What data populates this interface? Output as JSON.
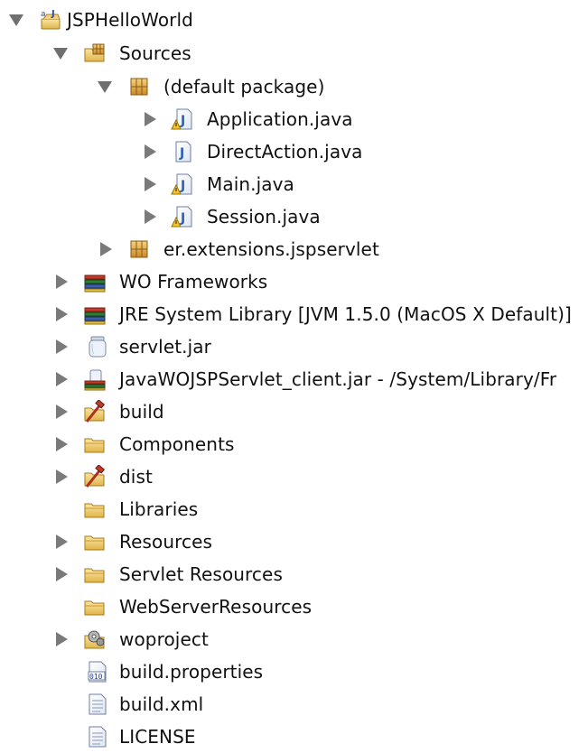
{
  "tree": {
    "root": {
      "label": "JSPHelloWorld",
      "icon": "web-project-icon",
      "state": "expanded"
    },
    "sources": {
      "label": "Sources",
      "icon": "source-folder-icon",
      "state": "expanded"
    },
    "default_package": {
      "label": "(default package)",
      "icon": "package-icon",
      "state": "expanded"
    },
    "files": [
      {
        "label": "Application.java",
        "icon": "java-file-warning-icon",
        "state": "collapsed"
      },
      {
        "label": "DirectAction.java",
        "icon": "java-file-icon",
        "state": "collapsed"
      },
      {
        "label": "Main.java",
        "icon": "java-file-warning-icon",
        "state": "collapsed"
      },
      {
        "label": "Session.java",
        "icon": "java-file-warning-icon",
        "state": "collapsed"
      }
    ],
    "er_package": {
      "label": "er.extensions.jspservlet",
      "icon": "package-icon",
      "state": "collapsed"
    },
    "items": [
      {
        "label": "WO Frameworks",
        "icon": "library-icon",
        "state": "collapsed"
      },
      {
        "label": "JRE System Library [JVM 1.5.0 (MacOS X Default)]",
        "icon": "library-icon",
        "state": "collapsed"
      },
      {
        "label": "servlet.jar",
        "icon": "jar-icon",
        "state": "collapsed"
      },
      {
        "label": "JavaWOJSPServlet_client.jar - /System/Library/Fr",
        "icon": "external-jar-icon",
        "state": "collapsed"
      },
      {
        "label": "build",
        "icon": "build-folder-icon",
        "state": "collapsed"
      },
      {
        "label": "Components",
        "icon": "folder-icon",
        "state": "collapsed"
      },
      {
        "label": "dist",
        "icon": "build-folder-icon",
        "state": "collapsed"
      },
      {
        "label": "Libraries",
        "icon": "folder-icon",
        "state": "leaf"
      },
      {
        "label": "Resources",
        "icon": "folder-icon",
        "state": "collapsed"
      },
      {
        "label": "Servlet Resources",
        "icon": "folder-icon",
        "state": "collapsed"
      },
      {
        "label": "WebServerResources",
        "icon": "folder-icon",
        "state": "leaf"
      },
      {
        "label": "woproject",
        "icon": "settings-folder-icon",
        "state": "collapsed"
      },
      {
        "label": "build.properties",
        "icon": "properties-file-icon",
        "state": "leaf"
      },
      {
        "label": "build.xml",
        "icon": "text-file-icon",
        "state": "leaf"
      },
      {
        "label": "LICENSE",
        "icon": "text-file-icon",
        "state": "leaf"
      }
    ]
  }
}
